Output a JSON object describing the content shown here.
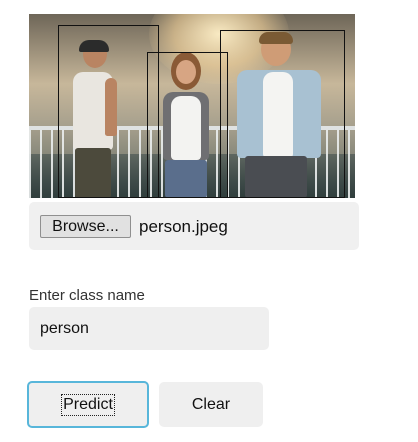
{
  "image_panel": {
    "subject": "three people standing by a railing near water",
    "detections": [
      {
        "label": "person"
      },
      {
        "label": "person"
      },
      {
        "label": "person"
      }
    ]
  },
  "file_upload": {
    "browse_label": "Browse...",
    "file_name": "person.jpeg"
  },
  "class_field": {
    "label": "Enter class name",
    "value": "person"
  },
  "actions": {
    "predict_label": "Predict",
    "clear_label": "Clear"
  },
  "colors": {
    "focus_border": "#58b6da",
    "field_background": "#efefef",
    "detection_box": "#111111"
  }
}
